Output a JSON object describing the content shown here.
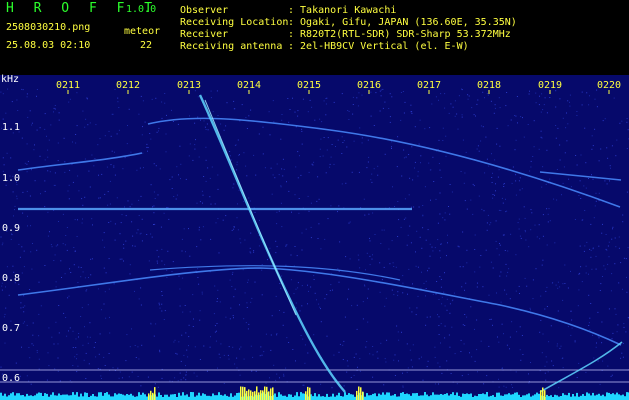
{
  "brand": "H R O F F T",
  "version": "1.0.0",
  "filename": "2508030210.png",
  "datetime": "25.08.03 02:10",
  "meteor_label": "meteor",
  "meteor_count": "22",
  "info": {
    "observer_label": "Observer",
    "observer_value": ": Takanori Kawachi",
    "location_label": "Receiving Location",
    "location_value": ": Ogaki, Gifu, JAPAN (136.60E, 35.35N)",
    "receiver_label": "Receiver",
    "receiver_value": ": R820T2(RTL-SDR) SDR-Sharp 53.372MHz",
    "antenna_label": "Receiving antenna",
    "antenna_value": ": 2el-HB9CV Vertical (el. E-W)"
  },
  "axis": {
    "unit": "kHz",
    "time_ticks": [
      "0211",
      "0212",
      "0213",
      "0214",
      "0215",
      "0216",
      "0217",
      "0218",
      "0219",
      "0220"
    ],
    "freq_ticks": [
      "1.1",
      "1.0",
      "0.9",
      "0.8",
      "0.7",
      "0.6"
    ]
  },
  "colors": {
    "background": "#06096b",
    "trace": "#4a8cff",
    "meteor": "#5fd6ff",
    "label_yellow": "#ffff40",
    "label_green": "#2cff2c"
  }
}
